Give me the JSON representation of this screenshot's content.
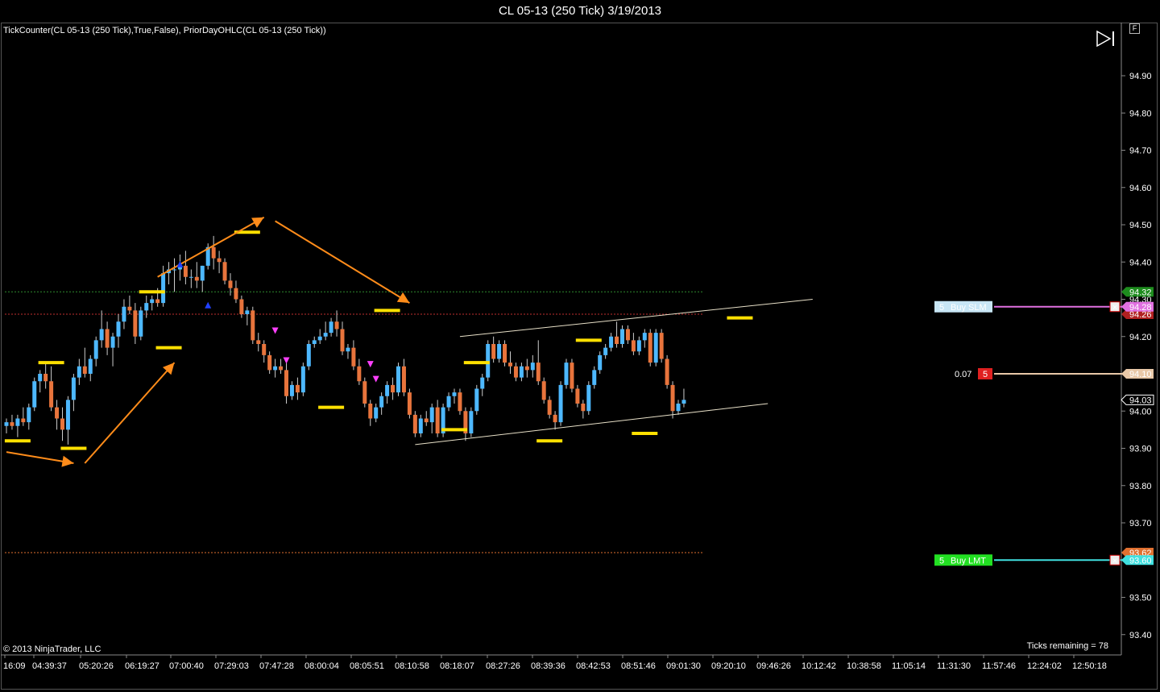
{
  "window": {
    "title": "CL 05-13 (250 Tick)  3/19/2013"
  },
  "indicators_text": "TickCounter(CL 05-13 (250 Tick),True,False), PriorDayOHLC(CL 05-13 (250 Tick))",
  "copyright": "© 2013 NinjaTrader, LLC",
  "ticks_remaining": "Ticks remaining = 78",
  "f_label": "F",
  "orders": {
    "buy_slm": {
      "qty": "5",
      "label": "Buy SLM",
      "price": "94.28"
    },
    "buy_lmt": {
      "qty": "5",
      "label": "Buy LMT",
      "price": "93.60"
    },
    "position": {
      "pnl": "0.07",
      "qty": "5",
      "price": "94.10"
    }
  },
  "price_badges": {
    "prior_high": "94.32",
    "prior_close": "94.26",
    "last": "94.03",
    "prior_low": "93.62"
  },
  "colors": {
    "up_candle": "#4db8ff",
    "down_candle": "#e8743c",
    "swing_marker": "#ffe000",
    "arrow": "#ff8c1a",
    "trendline": "#e8e0c8",
    "prior_high_line": "#2e8b2e",
    "prior_close_line": "#c03030",
    "prior_low_line": "#e07030",
    "buy_slm_line": "#e070e0",
    "buy_lmt_line": "#40e0e0",
    "position_line": "#e8c8a8"
  },
  "chart_data": {
    "type": "candlestick",
    "title": "CL 05-13 (250 Tick)  3/19/2013",
    "ylim": [
      93.34,
      94.99
    ],
    "y_ticks": [
      "94.90",
      "94.80",
      "94.70",
      "94.60",
      "94.50",
      "94.40",
      "94.30",
      "94.20",
      "94.10",
      "94.00",
      "93.90",
      "93.80",
      "93.70",
      "93.60",
      "93.50",
      "93.40"
    ],
    "x_ticks": [
      "16:09",
      "04:39:37",
      "05:20:26",
      "06:19:27",
      "07:00:40",
      "07:29:03",
      "07:47:28",
      "08:00:04",
      "08:05:51",
      "08:10:58",
      "08:18:07",
      "08:27:26",
      "08:39:36",
      "08:42:53",
      "08:51:46",
      "09:01:30",
      "09:20:10",
      "09:46:26",
      "10:12:42",
      "10:38:58",
      "11:05:14",
      "11:31:30",
      "11:57:46",
      "12:24:02",
      "12:50:18"
    ],
    "grid": false,
    "candles": [
      {
        "o": 93.96,
        "h": 93.98,
        "l": 93.94,
        "c": 93.97
      },
      {
        "o": 93.97,
        "h": 93.99,
        "l": 93.95,
        "c": 93.96
      },
      {
        "o": 93.96,
        "h": 93.99,
        "l": 93.93,
        "c": 93.98
      },
      {
        "o": 93.98,
        "h": 94.01,
        "l": 93.96,
        "c": 93.97
      },
      {
        "o": 93.97,
        "h": 94.02,
        "l": 93.95,
        "c": 94.01
      },
      {
        "o": 94.01,
        "h": 94.09,
        "l": 94.0,
        "c": 94.08
      },
      {
        "o": 94.08,
        "h": 94.11,
        "l": 94.05,
        "c": 94.1
      },
      {
        "o": 94.1,
        "h": 94.13,
        "l": 94.06,
        "c": 94.08
      },
      {
        "o": 94.08,
        "h": 94.12,
        "l": 94.0,
        "c": 94.01
      },
      {
        "o": 94.01,
        "h": 94.03,
        "l": 93.95,
        "c": 93.98
      },
      {
        "o": 93.98,
        "h": 94.01,
        "l": 93.92,
        "c": 93.95
      },
      {
        "o": 93.95,
        "h": 94.04,
        "l": 93.91,
        "c": 94.03
      },
      {
        "o": 94.03,
        "h": 94.1,
        "l": 94.0,
        "c": 94.09
      },
      {
        "o": 94.09,
        "h": 94.14,
        "l": 94.07,
        "c": 94.12
      },
      {
        "o": 94.12,
        "h": 94.17,
        "l": 94.09,
        "c": 94.1
      },
      {
        "o": 94.1,
        "h": 94.15,
        "l": 94.08,
        "c": 94.14
      },
      {
        "o": 94.14,
        "h": 94.2,
        "l": 94.12,
        "c": 94.19
      },
      {
        "o": 94.19,
        "h": 94.27,
        "l": 94.17,
        "c": 94.22
      },
      {
        "o": 94.22,
        "h": 94.24,
        "l": 94.15,
        "c": 94.17
      },
      {
        "o": 94.17,
        "h": 94.21,
        "l": 94.12,
        "c": 94.2
      },
      {
        "o": 94.2,
        "h": 94.26,
        "l": 94.17,
        "c": 94.24
      },
      {
        "o": 94.24,
        "h": 94.3,
        "l": 94.22,
        "c": 94.28
      },
      {
        "o": 94.28,
        "h": 94.31,
        "l": 94.26,
        "c": 94.27
      },
      {
        "o": 94.27,
        "h": 94.29,
        "l": 94.18,
        "c": 94.2
      },
      {
        "o": 94.2,
        "h": 94.28,
        "l": 94.19,
        "c": 94.27
      },
      {
        "o": 94.27,
        "h": 94.31,
        "l": 94.25,
        "c": 94.29
      },
      {
        "o": 94.29,
        "h": 94.31,
        "l": 94.27,
        "c": 94.3
      },
      {
        "o": 94.3,
        "h": 94.33,
        "l": 94.28,
        "c": 94.29
      },
      {
        "o": 94.29,
        "h": 94.39,
        "l": 94.28,
        "c": 94.37
      },
      {
        "o": 94.37,
        "h": 94.4,
        "l": 94.34,
        "c": 94.38
      },
      {
        "o": 94.38,
        "h": 94.41,
        "l": 94.32,
        "c": 94.38
      },
      {
        "o": 94.38,
        "h": 94.42,
        "l": 94.35,
        "c": 94.39
      },
      {
        "o": 94.39,
        "h": 94.43,
        "l": 94.34,
        "c": 94.36
      },
      {
        "o": 94.36,
        "h": 94.38,
        "l": 94.33,
        "c": 94.36
      },
      {
        "o": 94.36,
        "h": 94.4,
        "l": 94.33,
        "c": 94.35
      },
      {
        "o": 94.35,
        "h": 94.39,
        "l": 94.32,
        "c": 94.39
      },
      {
        "o": 94.39,
        "h": 94.45,
        "l": 94.38,
        "c": 94.44
      },
      {
        "o": 94.44,
        "h": 94.47,
        "l": 94.38,
        "c": 94.41
      },
      {
        "o": 94.41,
        "h": 94.43,
        "l": 94.37,
        "c": 94.4
      },
      {
        "o": 94.4,
        "h": 94.41,
        "l": 94.34,
        "c": 94.35
      },
      {
        "o": 94.35,
        "h": 94.37,
        "l": 94.31,
        "c": 94.33
      },
      {
        "o": 94.33,
        "h": 94.35,
        "l": 94.29,
        "c": 94.3
      },
      {
        "o": 94.3,
        "h": 94.31,
        "l": 94.25,
        "c": 94.26
      },
      {
        "o": 94.26,
        "h": 94.28,
        "l": 94.23,
        "c": 94.27
      },
      {
        "o": 94.27,
        "h": 94.28,
        "l": 94.18,
        "c": 94.19
      },
      {
        "o": 94.19,
        "h": 94.21,
        "l": 94.16,
        "c": 94.18
      },
      {
        "o": 94.18,
        "h": 94.19,
        "l": 94.13,
        "c": 94.15
      },
      {
        "o": 94.15,
        "h": 94.16,
        "l": 94.1,
        "c": 94.11
      },
      {
        "o": 94.11,
        "h": 94.14,
        "l": 94.09,
        "c": 94.12
      },
      {
        "o": 94.12,
        "h": 94.14,
        "l": 94.1,
        "c": 94.11
      },
      {
        "o": 94.11,
        "h": 94.13,
        "l": 94.02,
        "c": 94.04
      },
      {
        "o": 94.04,
        "h": 94.08,
        "l": 94.03,
        "c": 94.07
      },
      {
        "o": 94.07,
        "h": 94.09,
        "l": 94.03,
        "c": 94.05
      },
      {
        "o": 94.05,
        "h": 94.13,
        "l": 94.04,
        "c": 94.12
      },
      {
        "o": 94.12,
        "h": 94.19,
        "l": 94.11,
        "c": 94.18
      },
      {
        "o": 94.18,
        "h": 94.2,
        "l": 94.17,
        "c": 94.19
      },
      {
        "o": 94.19,
        "h": 94.22,
        "l": 94.18,
        "c": 94.2
      },
      {
        "o": 94.2,
        "h": 94.24,
        "l": 94.19,
        "c": 94.21
      },
      {
        "o": 94.21,
        "h": 94.25,
        "l": 94.2,
        "c": 94.24
      },
      {
        "o": 94.24,
        "h": 94.27,
        "l": 94.2,
        "c": 94.22
      },
      {
        "o": 94.22,
        "h": 94.24,
        "l": 94.15,
        "c": 94.16
      },
      {
        "o": 94.16,
        "h": 94.18,
        "l": 94.14,
        "c": 94.17
      },
      {
        "o": 94.17,
        "h": 94.19,
        "l": 94.11,
        "c": 94.12
      },
      {
        "o": 94.12,
        "h": 94.14,
        "l": 94.07,
        "c": 94.08
      },
      {
        "o": 94.08,
        "h": 94.09,
        "l": 94.01,
        "c": 94.02
      },
      {
        "o": 94.02,
        "h": 94.03,
        "l": 93.96,
        "c": 93.98
      },
      {
        "o": 93.98,
        "h": 94.02,
        "l": 93.97,
        "c": 94.01
      },
      {
        "o": 94.01,
        "h": 94.05,
        "l": 93.99,
        "c": 94.04
      },
      {
        "o": 94.04,
        "h": 94.08,
        "l": 94.02,
        "c": 94.07
      },
      {
        "o": 94.07,
        "h": 94.09,
        "l": 94.03,
        "c": 94.05
      },
      {
        "o": 94.05,
        "h": 94.13,
        "l": 94.04,
        "c": 94.12
      },
      {
        "o": 94.12,
        "h": 94.14,
        "l": 94.04,
        "c": 94.05
      },
      {
        "o": 94.05,
        "h": 94.06,
        "l": 93.98,
        "c": 93.99
      },
      {
        "o": 93.99,
        "h": 94.0,
        "l": 93.93,
        "c": 93.94
      },
      {
        "o": 93.94,
        "h": 93.99,
        "l": 93.93,
        "c": 93.98
      },
      {
        "o": 93.98,
        "h": 94.0,
        "l": 93.96,
        "c": 93.97
      },
      {
        "o": 93.97,
        "h": 94.02,
        "l": 93.94,
        "c": 94.01
      },
      {
        "o": 94.01,
        "h": 94.03,
        "l": 93.93,
        "c": 93.94
      },
      {
        "o": 93.94,
        "h": 94.02,
        "l": 93.93,
        "c": 94.01
      },
      {
        "o": 94.01,
        "h": 94.05,
        "l": 94.0,
        "c": 94.04
      },
      {
        "o": 94.04,
        "h": 94.06,
        "l": 94.02,
        "c": 94.05
      },
      {
        "o": 94.05,
        "h": 94.06,
        "l": 93.99,
        "c": 94.0
      },
      {
        "o": 94.0,
        "h": 94.01,
        "l": 93.92,
        "c": 93.94
      },
      {
        "o": 93.94,
        "h": 94.01,
        "l": 93.93,
        "c": 94.0
      },
      {
        "o": 94.0,
        "h": 94.07,
        "l": 93.99,
        "c": 94.06
      },
      {
        "o": 94.06,
        "h": 94.1,
        "l": 94.04,
        "c": 94.09
      },
      {
        "o": 94.09,
        "h": 94.19,
        "l": 94.08,
        "c": 94.18
      },
      {
        "o": 94.18,
        "h": 94.2,
        "l": 94.13,
        "c": 94.14
      },
      {
        "o": 94.14,
        "h": 94.19,
        "l": 94.13,
        "c": 94.18
      },
      {
        "o": 94.18,
        "h": 94.19,
        "l": 94.12,
        "c": 94.13
      },
      {
        "o": 94.13,
        "h": 94.16,
        "l": 94.1,
        "c": 94.12
      },
      {
        "o": 94.12,
        "h": 94.13,
        "l": 94.08,
        "c": 94.09
      },
      {
        "o": 94.09,
        "h": 94.13,
        "l": 94.08,
        "c": 94.12
      },
      {
        "o": 94.12,
        "h": 94.14,
        "l": 94.09,
        "c": 94.11
      },
      {
        "o": 94.11,
        "h": 94.15,
        "l": 94.09,
        "c": 94.13
      },
      {
        "o": 94.13,
        "h": 94.19,
        "l": 94.07,
        "c": 94.08
      },
      {
        "o": 94.08,
        "h": 94.09,
        "l": 94.02,
        "c": 94.03
      },
      {
        "o": 94.03,
        "h": 94.04,
        "l": 93.98,
        "c": 93.99
      },
      {
        "o": 93.99,
        "h": 94.0,
        "l": 93.95,
        "c": 93.97
      },
      {
        "o": 93.97,
        "h": 94.08,
        "l": 93.96,
        "c": 94.07
      },
      {
        "o": 94.07,
        "h": 94.14,
        "l": 94.06,
        "c": 94.13
      },
      {
        "o": 94.13,
        "h": 94.14,
        "l": 94.05,
        "c": 94.06
      },
      {
        "o": 94.06,
        "h": 94.07,
        "l": 94.01,
        "c": 94.02
      },
      {
        "o": 94.02,
        "h": 94.03,
        "l": 93.98,
        "c": 94.0
      },
      {
        "o": 94.0,
        "h": 94.08,
        "l": 93.99,
        "c": 94.07
      },
      {
        "o": 94.07,
        "h": 94.12,
        "l": 94.06,
        "c": 94.11
      },
      {
        "o": 94.11,
        "h": 94.16,
        "l": 94.1,
        "c": 94.15
      },
      {
        "o": 94.15,
        "h": 94.18,
        "l": 94.14,
        "c": 94.17
      },
      {
        "o": 94.17,
        "h": 94.21,
        "l": 94.16,
        "c": 94.2
      },
      {
        "o": 94.2,
        "h": 94.24,
        "l": 94.17,
        "c": 94.18
      },
      {
        "o": 94.18,
        "h": 94.23,
        "l": 94.17,
        "c": 94.22
      },
      {
        "o": 94.22,
        "h": 94.23,
        "l": 94.18,
        "c": 94.19
      },
      {
        "o": 94.19,
        "h": 94.21,
        "l": 94.15,
        "c": 94.16
      },
      {
        "o": 94.16,
        "h": 94.2,
        "l": 94.15,
        "c": 94.19
      },
      {
        "o": 94.19,
        "h": 94.22,
        "l": 94.17,
        "c": 94.21
      },
      {
        "o": 94.21,
        "h": 94.22,
        "l": 94.12,
        "c": 94.13
      },
      {
        "o": 94.13,
        "h": 94.22,
        "l": 94.12,
        "c": 94.21
      },
      {
        "o": 94.21,
        "h": 94.22,
        "l": 94.13,
        "c": 94.14
      },
      {
        "o": 94.14,
        "h": 94.15,
        "l": 94.06,
        "c": 94.07
      },
      {
        "o": 94.07,
        "h": 94.08,
        "l": 93.98,
        "c": 94.0
      },
      {
        "o": 94.0,
        "h": 94.03,
        "l": 93.99,
        "c": 94.02
      },
      {
        "o": 94.02,
        "h": 94.06,
        "l": 94.01,
        "c": 94.03
      }
    ],
    "horizontal_lines": [
      {
        "name": "prior-high",
        "value": 94.32
      },
      {
        "name": "prior-close",
        "value": 94.26
      },
      {
        "name": "prior-low",
        "value": 93.62
      }
    ],
    "trendlines": [
      {
        "from": {
          "bar": 81,
          "price": 94.2
        },
        "to": {
          "bar": 144,
          "price": 94.3
        }
      },
      {
        "from": {
          "bar": 73,
          "price": 93.91
        },
        "to": {
          "bar": 136,
          "price": 94.02
        }
      }
    ],
    "swing_markers": [
      {
        "bar": 2,
        "price": 93.92
      },
      {
        "bar": 8,
        "price": 94.13
      },
      {
        "bar": 12,
        "price": 93.9
      },
      {
        "bar": 26,
        "price": 94.32
      },
      {
        "bar": 29,
        "price": 94.17
      },
      {
        "bar": 43,
        "price": 94.48
      },
      {
        "bar": 58,
        "price": 94.01
      },
      {
        "bar": 68,
        "price": 94.27
      },
      {
        "bar": 80,
        "price": 93.95
      },
      {
        "bar": 84,
        "price": 94.13
      },
      {
        "bar": 97,
        "price": 93.92
      },
      {
        "bar": 104,
        "price": 94.19
      },
      {
        "bar": 114,
        "price": 93.94
      },
      {
        "bar": 131,
        "price": 94.25
      }
    ],
    "arrows": [
      {
        "from": {
          "bar": 0,
          "price": 93.89
        },
        "to": {
          "bar": 12,
          "price": 93.86
        }
      },
      {
        "from": {
          "bar": 14,
          "price": 93.86
        },
        "to": {
          "bar": 30,
          "price": 94.13
        }
      },
      {
        "from": {
          "bar": 27,
          "price": 94.36
        },
        "to": {
          "bar": 46,
          "price": 94.52
        }
      },
      {
        "from": {
          "bar": 48,
          "price": 94.51
        },
        "to": {
          "bar": 72,
          "price": 94.29
        }
      }
    ]
  }
}
